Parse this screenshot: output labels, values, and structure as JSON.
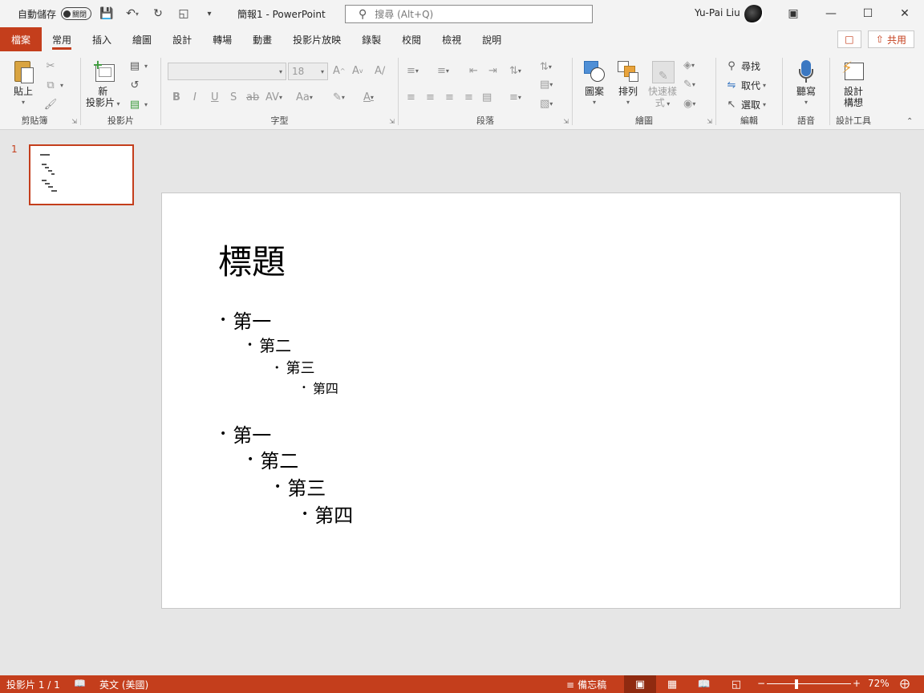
{
  "titlebar": {
    "autosave_label": "自動儲存",
    "autosave_state": "關閉",
    "doc_title": "簡報1  -  PowerPoint",
    "search_placeholder": "搜尋 (Alt+Q)",
    "user_name": "Yu-Pai Liu"
  },
  "tabs": [
    "檔案",
    "常用",
    "插入",
    "繪圖",
    "設計",
    "轉場",
    "動畫",
    "投影片放映",
    "錄製",
    "校閱",
    "檢視",
    "說明"
  ],
  "active_tab": "常用",
  "share_label": "共用",
  "ribbon": {
    "clipboard": {
      "label": "剪貼簿",
      "paste": "貼上"
    },
    "slides": {
      "label": "投影片",
      "new_slide_1": "新",
      "new_slide_2": "投影片"
    },
    "font": {
      "label": "字型",
      "font_name": "",
      "font_size": "18"
    },
    "paragraph": {
      "label": "段落"
    },
    "drawing": {
      "label": "繪圖",
      "shapes": "圖案",
      "arrange": "排列",
      "quick_styles_1": "快速樣",
      "quick_styles_2": "式"
    },
    "editing": {
      "label": "編輯",
      "find": "尋找",
      "replace": "取代",
      "select": "選取"
    },
    "voice": {
      "label": "語音",
      "dictate": "聽寫"
    },
    "designer": {
      "label": "設計工具",
      "design_ideas_1": "設計",
      "design_ideas_2": "構想"
    }
  },
  "thumbnail": {
    "number": "1"
  },
  "slide": {
    "title": "標題",
    "bullets": [
      {
        "text": "第一",
        "level": 1
      },
      {
        "text": "第二",
        "level": 2
      },
      {
        "text": "第三",
        "level": 3
      },
      {
        "text": "第四",
        "level": 4
      },
      {
        "text": "第一",
        "level": 1
      },
      {
        "text": "第二",
        "level": 2
      },
      {
        "text": "第三",
        "level": 3
      },
      {
        "text": "第四",
        "level": 4
      }
    ]
  },
  "statusbar": {
    "slide_count": "投影片 1 / 1",
    "language": "英文 (美國)",
    "notes": "備忘稿",
    "zoom_minus": "−",
    "zoom_plus": "+",
    "zoom": "72%",
    "zoom_fraction": 0.35
  }
}
